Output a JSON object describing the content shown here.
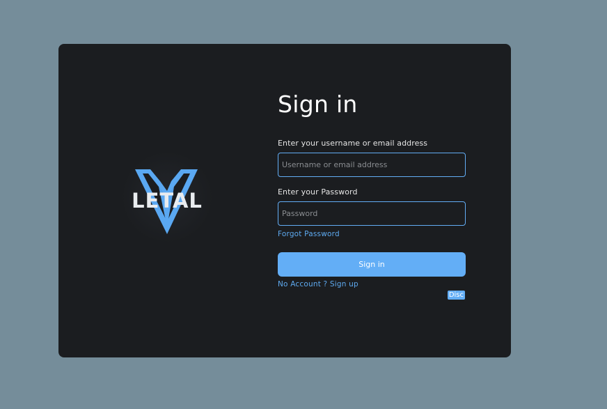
{
  "brand": {
    "logo_text": "LETAL",
    "accent_color": "#63aef6",
    "card_color": "#1b1d20",
    "background_color": "#758d9a"
  },
  "form": {
    "title": "Sign in",
    "username_label": "Enter your username or email address",
    "username_placeholder": "Username or email address",
    "password_label": "Enter your Password",
    "password_placeholder": "Password",
    "forgot_password": "Forgot Password",
    "submit_label": "Sign in",
    "signup_link": "No Account ? Sign up",
    "disc_label": "Disc"
  }
}
